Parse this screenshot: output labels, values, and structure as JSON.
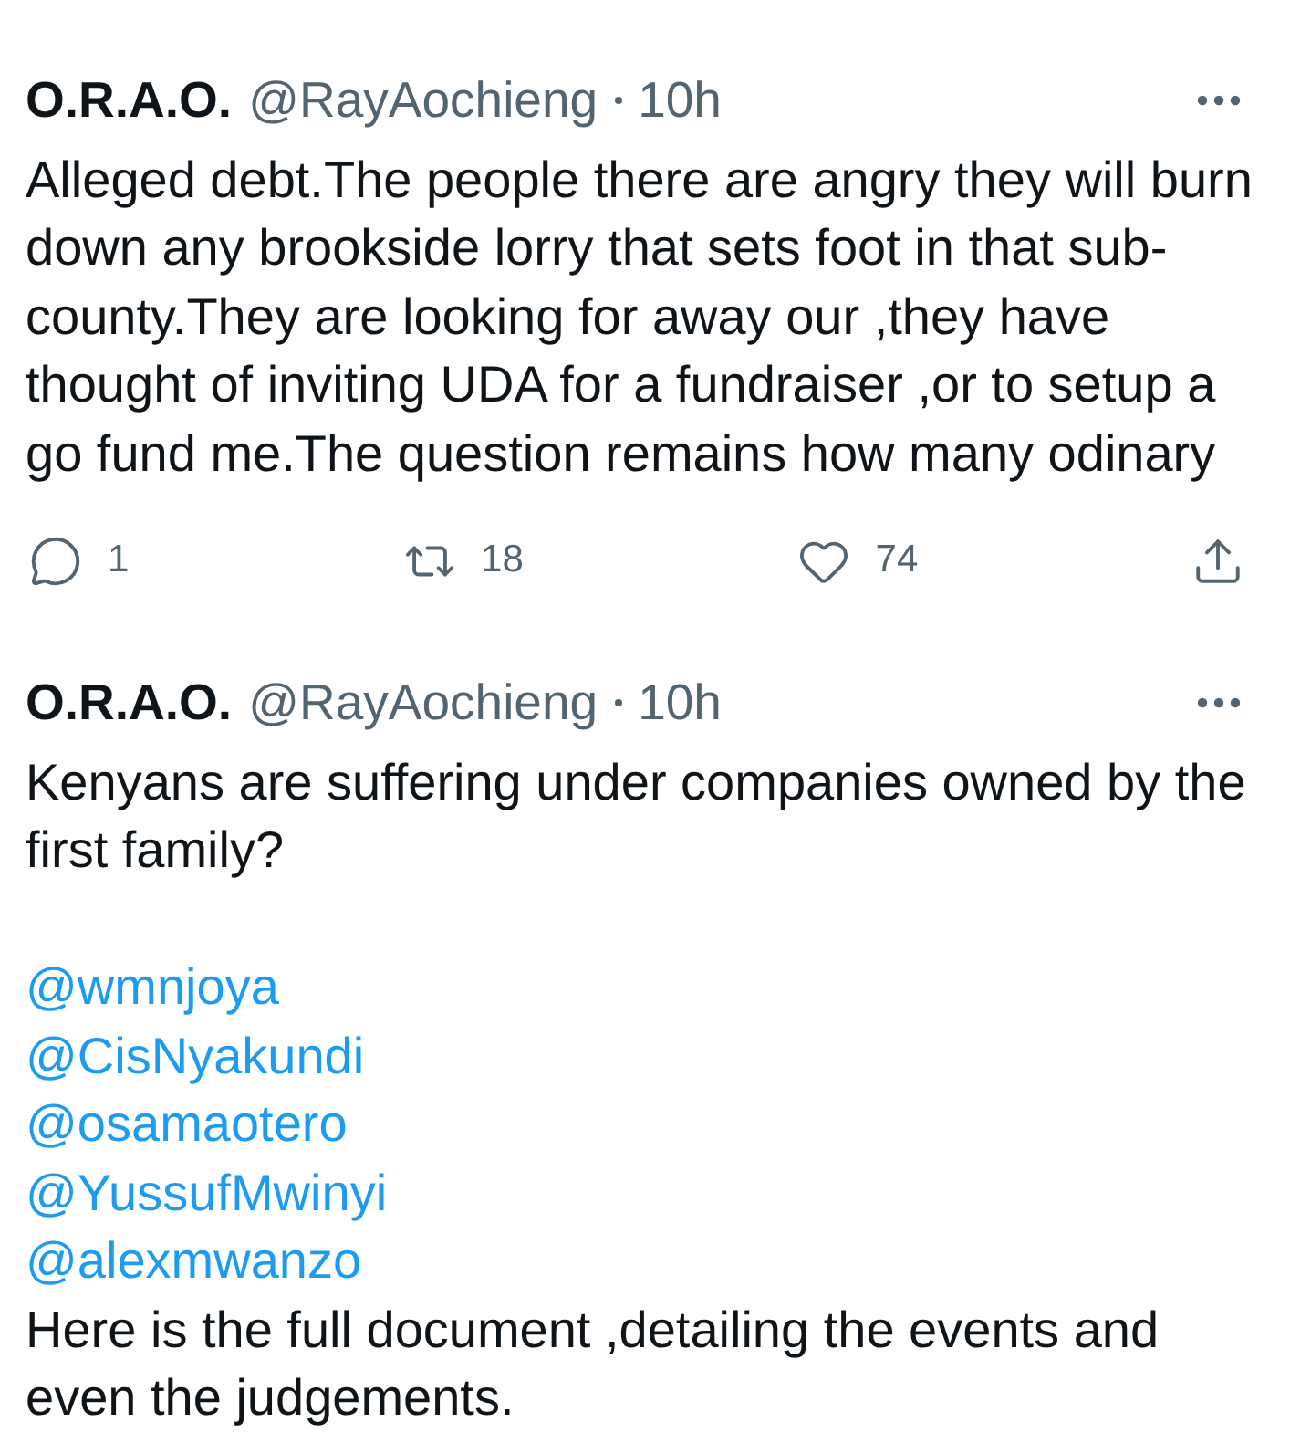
{
  "tweets": [
    {
      "author": {
        "name": "O.R.A.O.",
        "handle": "@RayAochieng",
        "time": "10h"
      },
      "body": [
        {
          "kind": "text",
          "text": "Alleged debt.The people there are angry they will burn down any brookside lorry that sets foot in that sub-county.They are looking for away our ,they have thought of inviting UDA for a fundraiser ,or to setup a go fund me.The question remains how many odinary"
        }
      ],
      "actions": [
        {
          "kind": "reply",
          "count": "1"
        },
        {
          "kind": "retweet",
          "count": "18"
        },
        {
          "kind": "like",
          "count": "74"
        },
        {
          "kind": "share"
        }
      ]
    },
    {
      "author": {
        "name": "O.R.A.O.",
        "handle": "@RayAochieng",
        "time": "10h"
      },
      "body": [
        {
          "kind": "text",
          "text": "Kenyans are suffering under companies owned by the first family?"
        },
        {
          "kind": "mentions",
          "items": [
            "@wmnjoya",
            "@CisNyakundi",
            "@osamaotero",
            "@YussufMwinyi",
            "@alexmwanzo"
          ]
        },
        {
          "kind": "text",
          "text": "Here is the full document ,detailing the events and even the judgements."
        }
      ]
    }
  ]
}
